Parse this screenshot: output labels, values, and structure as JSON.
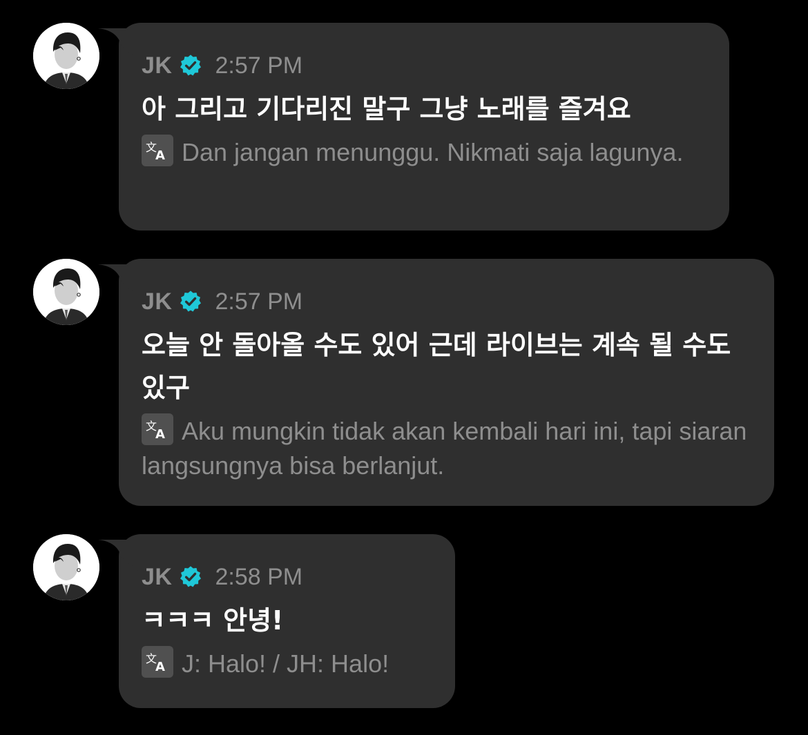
{
  "messages": [
    {
      "sender": "JK",
      "verified_icon": "verified-badge-icon",
      "time": "2:57 PM",
      "text": "아 그리고 기다리진 말구 그냥 노래를 즐겨요",
      "translation": "Dan jangan menunggu. Nikmati saja lagunya."
    },
    {
      "sender": "JK",
      "verified_icon": "verified-badge-icon",
      "time": "2:57 PM",
      "text": "오늘 안 돌아올 수도 있어 근데 라이브는 계속 될 수도 있구",
      "translation": "Aku mungkin tidak akan kembali hari ini, tapi siaran langsungnya bisa berlanjut."
    },
    {
      "sender": "JK",
      "verified_icon": "verified-badge-icon",
      "time": "2:58 PM",
      "text": "ㅋㅋㅋ 안녕!",
      "translation": "J: Halo! / JH: Halo!"
    }
  ],
  "colors": {
    "background": "#000000",
    "bubble": "#2f2f2f",
    "verified": "#1fc8d8",
    "meta_text": "#8e8e8e",
    "message_text": "#ffffff"
  },
  "icons": {
    "translate": "translate-icon",
    "avatar": "avatar"
  }
}
